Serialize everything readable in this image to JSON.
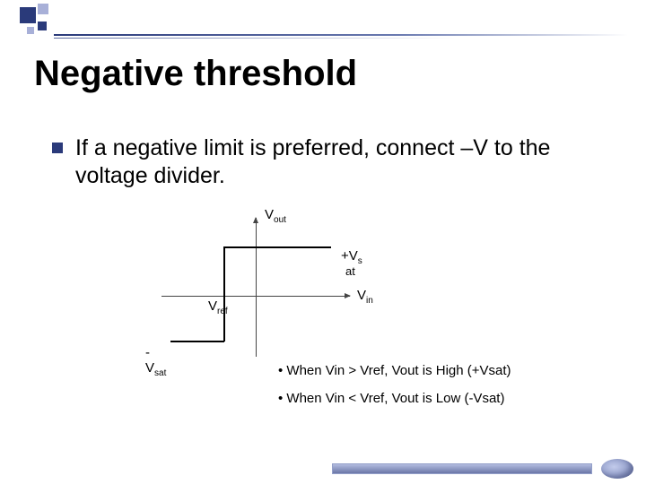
{
  "title": "Negative threshold",
  "bullet": "If a negative limit is preferred, connect –V to the voltage divider.",
  "chart_data": {
    "type": "line",
    "title": "",
    "xlabel": "Vin",
    "ylabel": "Vout",
    "annotations": {
      "high_level": "+Vsat",
      "low_level": "-Vsat",
      "threshold": "Vref"
    },
    "series": [
      {
        "name": "Vout",
        "points": [
          {
            "x": "-inf",
            "y": "-Vsat"
          },
          {
            "x": "Vref",
            "y": "-Vsat"
          },
          {
            "x": "Vref",
            "y": "+Vsat"
          },
          {
            "x": "+inf",
            "y": "+Vsat"
          }
        ]
      }
    ],
    "threshold_sign": "negative"
  },
  "labels": {
    "vout": "V",
    "vout_sub": "out",
    "plus_vs": "+V",
    "plus_vs_sub": "s",
    "at": "at",
    "vref": "V",
    "vref_sub": "ref",
    "vin": "V",
    "vin_sub": "in",
    "neg": "-",
    "vsat": "V",
    "vsat_sub": "sat"
  },
  "notes": {
    "n1": "• When Vin > Vref, Vout is High (+Vsat)",
    "n2": "• When Vin < Vref, Vout is Low (-Vsat)"
  }
}
